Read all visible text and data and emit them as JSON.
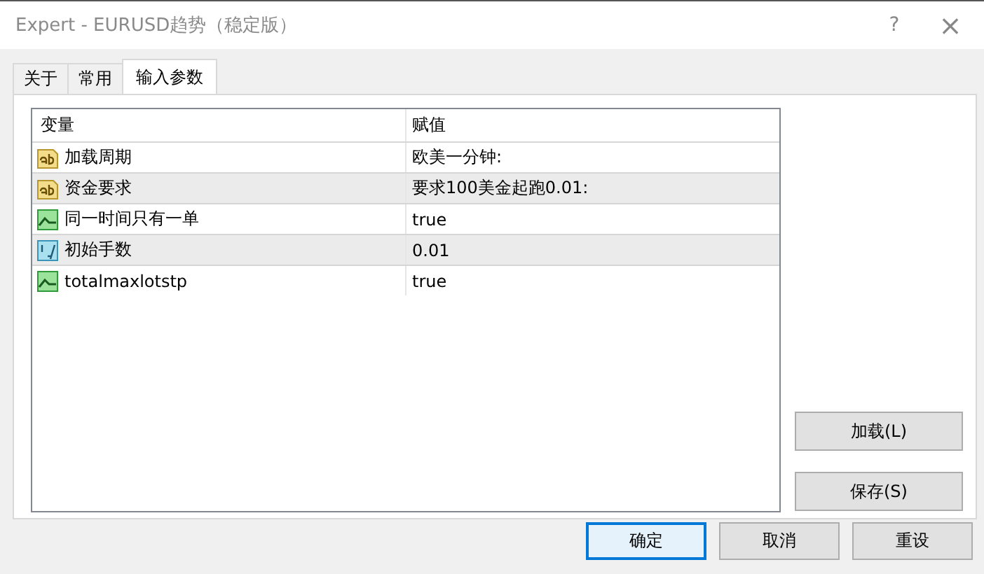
{
  "window": {
    "title": "Expert - EURUSD趋势（稳定版）",
    "help": "?",
    "close": "×"
  },
  "tabs": [
    {
      "label": "关于",
      "selected": false
    },
    {
      "label": "常用",
      "selected": false
    },
    {
      "label": "输入参数",
      "selected": true
    }
  ],
  "table": {
    "columns": [
      "变量",
      "赋值"
    ],
    "rows": [
      {
        "kind": "string",
        "name": "加载周期",
        "value": "欧美一分钟:"
      },
      {
        "kind": "string",
        "name": "资金要求",
        "value": "要求100美金起跑0.01:"
      },
      {
        "kind": "bool",
        "name": "同一时间只有一单",
        "value": "true"
      },
      {
        "kind": "double",
        "name": "初始手数",
        "value": "0.01"
      },
      {
        "kind": "bool",
        "name": "totalmaxlotstp",
        "value": "true"
      }
    ]
  },
  "side_buttons": [
    "加载(L)",
    "保存(S)"
  ],
  "buttons": [
    {
      "label": "确定",
      "default": true
    },
    {
      "label": "取消",
      "default": false
    },
    {
      "label": "重设",
      "default": false
    }
  ]
}
